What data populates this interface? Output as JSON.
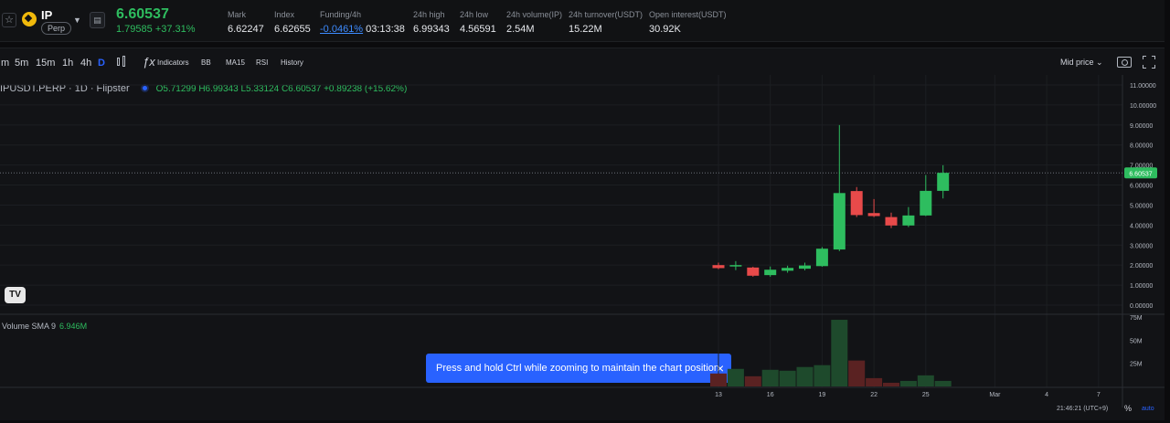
{
  "ticker": {
    "symbol": "IP",
    "badge": "Perp",
    "last_price": "6.60537",
    "change": "1.79585 +37.31%",
    "stats": [
      {
        "label": "Mark",
        "value": "6.62247"
      },
      {
        "label": "Index",
        "value": "6.62655"
      },
      {
        "label": "Funding/4h",
        "rate": "-0.0461%",
        "countdown": "03:13:38"
      },
      {
        "label": "24h high",
        "value": "6.99343"
      },
      {
        "label": "24h low",
        "value": "4.56591"
      },
      {
        "label": "24h volume(IP)",
        "value": "2.54M"
      },
      {
        "label": "24h turnover(USDT)",
        "value": "15.22M"
      },
      {
        "label": "Open interest(USDT)",
        "value": "30.92K"
      }
    ]
  },
  "toolbar": {
    "timeframes": [
      "m",
      "5m",
      "15m",
      "1h",
      "4h",
      "D"
    ],
    "active_timeframe": "D",
    "indicators_label": "Indicators",
    "studies": [
      "BB",
      "MA15",
      "RSI"
    ],
    "history_label": "History",
    "mid_price_label": "Mid price"
  },
  "legend": {
    "title": "IPUSDT.PERP · 1D · Flipster",
    "ohlc": "O5.71299 H6.99343 L5.33124 C6.60537 +0.89238 (+15.62%)"
  },
  "volume_legend": {
    "label": "Volume SMA 9",
    "value": "6.946M"
  },
  "tv_logo": "TV",
  "toast": {
    "message": "Press and hold Ctrl while zooming to maintain the chart position",
    "close": "×"
  },
  "footer": {
    "time": "21:46:21 (UTC+9)",
    "percent": "%",
    "auto": "auto"
  },
  "colors": {
    "up": "#2ebd5f",
    "down": "#e84a4a",
    "accent": "#2962ff"
  },
  "chart_data": {
    "type": "candlestick",
    "price_axis_labels": [
      "11.00000",
      "10.00000",
      "9.00000",
      "8.00000",
      "7.00000",
      "6.00000",
      "5.00000",
      "4.00000",
      "3.00000",
      "2.00000",
      "1.00000",
      "0.00000"
    ],
    "price_range": [
      0,
      11
    ],
    "last_price_label": "6.60537",
    "volume_axis_labels": [
      "75M",
      "50M",
      "25M"
    ],
    "volume_range": [
      0,
      75
    ],
    "x_axis_labels": [
      {
        "label": "13",
        "index": 0
      },
      {
        "label": "16",
        "index": 3
      },
      {
        "label": "19",
        "index": 6
      },
      {
        "label": "22",
        "index": 9
      },
      {
        "label": "25",
        "index": 12
      },
      {
        "label": "Mar",
        "index": 16
      },
      {
        "label": "4",
        "index": 19
      },
      {
        "label": "7",
        "index": 22
      }
    ],
    "candles": [
      {
        "o": 2.0,
        "h": 2.12,
        "l": 1.8,
        "c": 1.85,
        "v": 14
      },
      {
        "o": 2.0,
        "h": 2.2,
        "l": 1.75,
        "c": 2.0,
        "v": 19
      },
      {
        "o": 1.88,
        "h": 1.92,
        "l": 1.42,
        "c": 1.47,
        "v": 11
      },
      {
        "o": 1.5,
        "h": 1.93,
        "l": 1.42,
        "c": 1.77,
        "v": 18
      },
      {
        "o": 1.72,
        "h": 1.97,
        "l": 1.62,
        "c": 1.86,
        "v": 17
      },
      {
        "o": 1.82,
        "h": 2.12,
        "l": 1.74,
        "c": 1.98,
        "v": 21
      },
      {
        "o": 1.95,
        "h": 2.9,
        "l": 1.92,
        "c": 2.82,
        "v": 23
      },
      {
        "o": 2.78,
        "h": 9.0,
        "l": 2.7,
        "c": 5.6,
        "v": 72
      },
      {
        "o": 5.7,
        "h": 5.9,
        "l": 4.4,
        "c": 4.5,
        "v": 28
      },
      {
        "o": 4.6,
        "h": 5.3,
        "l": 4.4,
        "c": 4.45,
        "v": 9
      },
      {
        "o": 4.4,
        "h": 4.62,
        "l": 3.85,
        "c": 3.98,
        "v": 4
      },
      {
        "o": 3.98,
        "h": 4.9,
        "l": 3.9,
        "c": 4.48,
        "v": 6
      },
      {
        "o": 4.48,
        "h": 6.5,
        "l": 4.45,
        "c": 5.71,
        "v": 12
      },
      {
        "o": 5.71,
        "h": 6.99,
        "l": 5.33,
        "c": 6.61,
        "v": 6
      }
    ]
  }
}
